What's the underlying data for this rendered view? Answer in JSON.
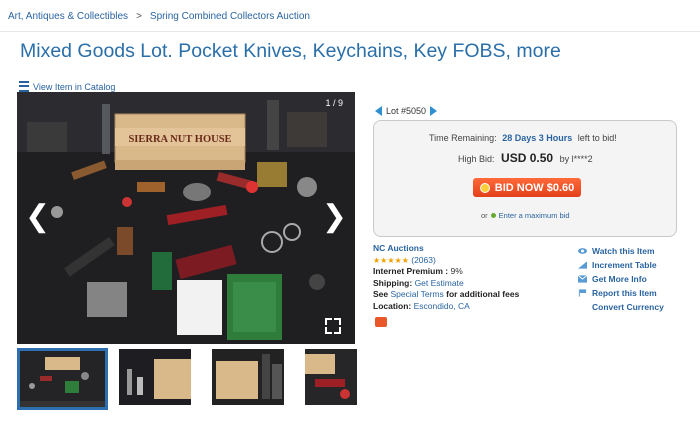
{
  "breadcrumb": {
    "items": [
      "Art, Antiques & Collectibles",
      "Spring Combined Collectors Auction"
    ],
    "separator": ">"
  },
  "page_title": "Mixed Goods Lot. Pocket Knives, Keychains, Key FOBS, more",
  "view_in_catalog": "View Item in Catalog",
  "viewer": {
    "counter": "1 / 9",
    "crate_text": "SIERRA NUT HOUSE"
  },
  "lot": {
    "label": "Lot #5050"
  },
  "bid_panel": {
    "time_label": "Time Remaining:",
    "time_value": "28 Days 3 Hours",
    "time_suffix": "left to bid!",
    "high_bid_label": "High Bid:",
    "high_bid_value": "USD 0.50",
    "high_bid_by": "by l****2",
    "bid_button": "BID NOW $0.60",
    "max_bid_prefix": "or",
    "max_bid_link": "Enter a maximum bid"
  },
  "seller": {
    "name": "NC Auctions",
    "stars": "★★★★★",
    "reviews": "(2063)",
    "premium_label": "Internet Premium :",
    "premium_value": "9%",
    "shipping_label": "Shipping:",
    "shipping_value": "Get Estimate",
    "terms_prefix": "See",
    "terms_link": "Special Terms",
    "terms_suffix": "for additional fees",
    "location_label": "Location:",
    "location_value": "Escondido, CA"
  },
  "actions": [
    {
      "label": "Watch this Item",
      "icon": "eye-icon"
    },
    {
      "label": "Increment Table",
      "icon": "chart-icon"
    },
    {
      "label": "Get More Info",
      "icon": "mail-icon"
    },
    {
      "label": "Report this Item",
      "icon": "flag-icon"
    },
    {
      "label": "Convert Currency",
      "icon": ""
    }
  ],
  "colors": {
    "link": "#2a64a0",
    "title": "#2a6fa8",
    "bid_button": "#e8502a",
    "thumb_active_border": "#2d6fb0"
  }
}
